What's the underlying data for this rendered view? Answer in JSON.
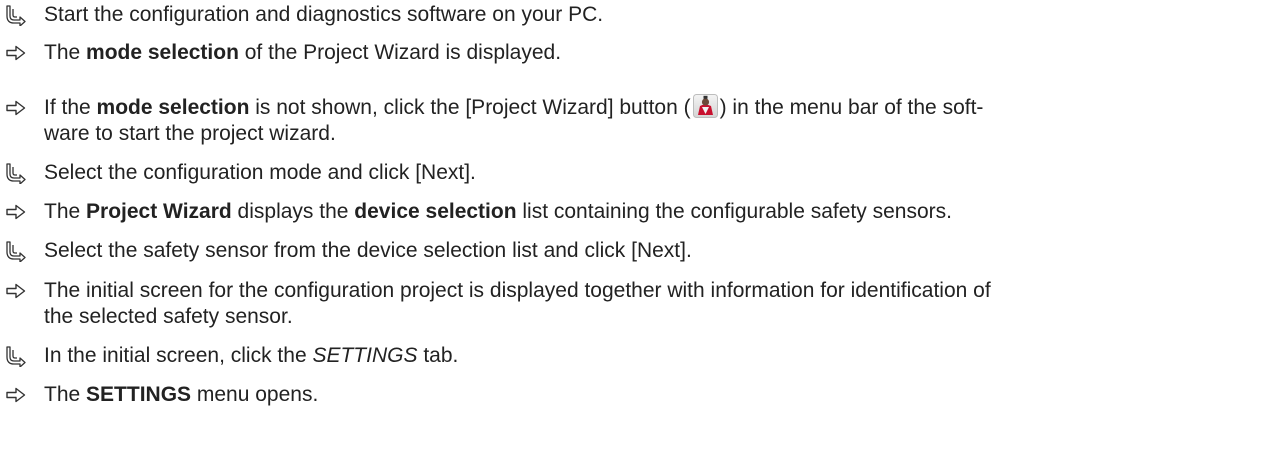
{
  "icons": {
    "action": "hand-pointing-down-right-icon",
    "result": "arrow-right-outline-icon",
    "project_wizard_button": "project-wizard-button-icon"
  },
  "steps": [
    {
      "type": "action",
      "parts": [
        {
          "t": "Start the configuration and diagnostics software on your PC."
        }
      ]
    },
    {
      "type": "result",
      "parts": [
        {
          "t": "The "
        },
        {
          "t": "mode selection",
          "b": true
        },
        {
          "t": " of the Project Wizard is displayed."
        }
      ]
    },
    {
      "type": "result",
      "parts": [
        {
          "t": "If the "
        },
        {
          "t": "mode selection",
          "b": true
        },
        {
          "t": " is not shown, click the [Project Wizard] button ("
        },
        {
          "icon": "project_wizard_button"
        },
        {
          "t": ") in the menu bar of the soft-"
        }
      ]
    },
    {
      "type": "continuation",
      "parts": [
        {
          "t": "ware to start the project wizard."
        }
      ]
    },
    {
      "type": "action",
      "parts": [
        {
          "t": "Select the configuration mode and click [Next]."
        }
      ]
    },
    {
      "type": "result",
      "parts": [
        {
          "t": "The "
        },
        {
          "t": "Project Wizard",
          "b": true
        },
        {
          "t": " displays the "
        },
        {
          "t": "device selection",
          "b": true
        },
        {
          "t": " list containing the configurable safety sensors."
        }
      ]
    },
    {
      "type": "action",
      "parts": [
        {
          "t": "Select the safety sensor from the device selection list and click [Next]."
        }
      ]
    },
    {
      "type": "result",
      "parts": [
        {
          "t": "The initial screen for the configuration project is displayed together with information for identification of"
        }
      ]
    },
    {
      "type": "continuation",
      "parts": [
        {
          "t": "the selected safety sensor."
        }
      ]
    },
    {
      "type": "action",
      "parts": [
        {
          "t": "In the initial screen, click the "
        },
        {
          "t": "SETTINGS",
          "i": true
        },
        {
          "t": " tab."
        }
      ]
    },
    {
      "type": "result",
      "parts": [
        {
          "t": "The "
        },
        {
          "t": "SETTINGS",
          "b": true
        },
        {
          "t": " menu opens."
        }
      ]
    }
  ]
}
